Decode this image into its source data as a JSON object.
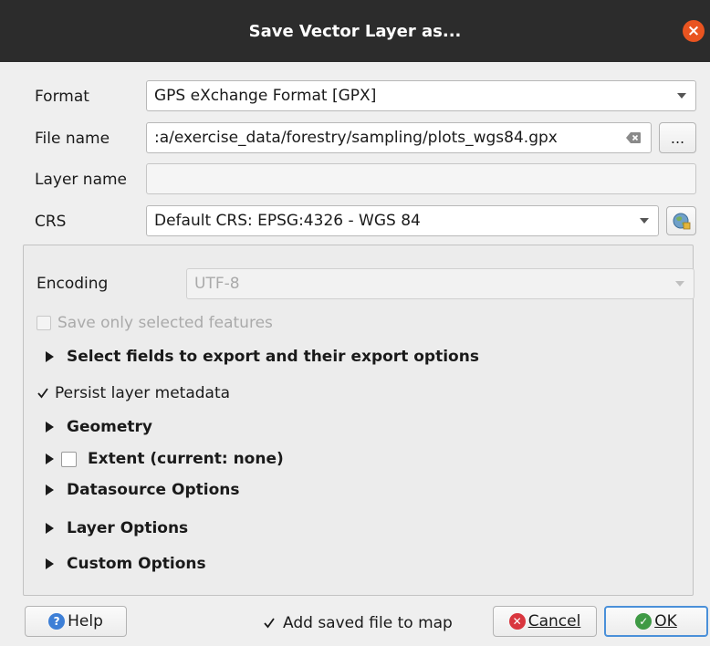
{
  "window": {
    "title": "Save Vector Layer as..."
  },
  "form": {
    "format_label": "Format",
    "format_value": "GPS eXchange Format [GPX]",
    "filename_label": "File name",
    "filename_value": ":a/exercise_data/forestry/sampling/plots_wgs84.gpx",
    "browse_label": "...",
    "layername_label": "Layer name",
    "layername_value": "",
    "crs_label": "CRS",
    "crs_value": "Default CRS: EPSG:4326 - WGS 84"
  },
  "options": {
    "encoding_label": "Encoding",
    "encoding_value": "UTF-8",
    "save_selected_label": "Save only selected features",
    "select_fields_label": "Select fields to export and their export options",
    "persist_metadata_label": "Persist layer metadata",
    "persist_metadata_checked": true,
    "geometry_label": "Geometry",
    "extent_label": "Extent (current: none)",
    "datasource_label": "Datasource Options",
    "layer_options_label": "Layer Options",
    "custom_options_label": "Custom Options"
  },
  "footer": {
    "help_label": "Help",
    "add_to_map_label": "Add saved file to map",
    "add_to_map_checked": true,
    "cancel_label": "Cancel",
    "ok_label": "OK"
  },
  "colors": {
    "titlebar": "#2c2c2c",
    "close": "#e95420",
    "help_icon": "#3d7fd6",
    "cancel_icon": "#d9363e",
    "ok_icon": "#3f9a45"
  }
}
